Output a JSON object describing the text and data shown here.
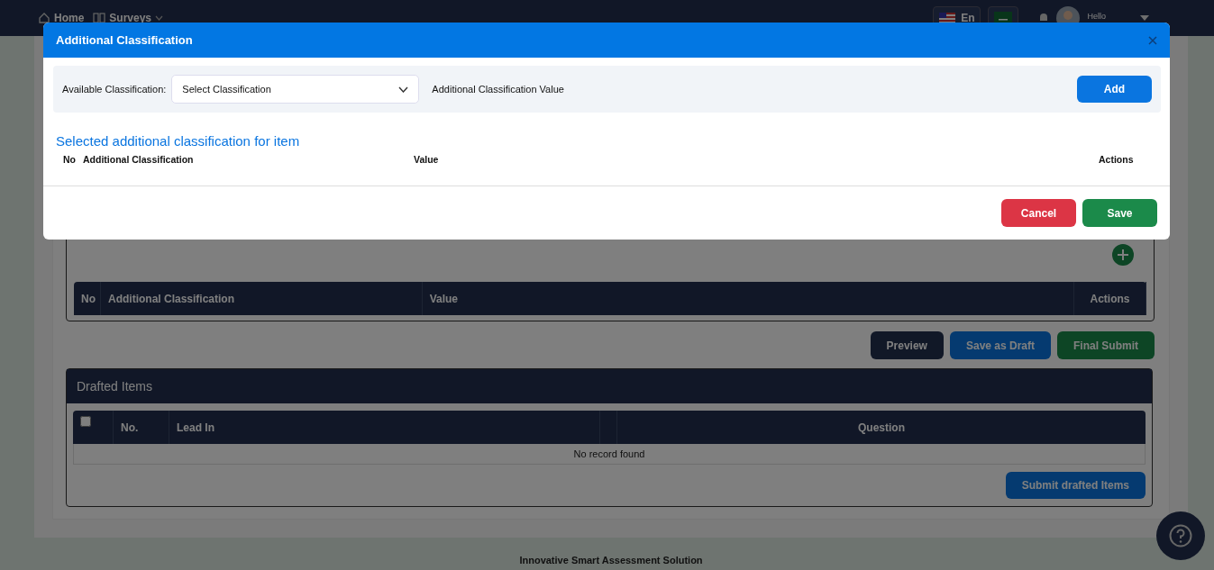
{
  "navbar": {
    "links": [
      {
        "label": "Home",
        "kind": "home",
        "dropdown": false
      },
      {
        "label": "Surveys",
        "kind": "book",
        "dropdown": true
      }
    ],
    "language": {
      "label": "En"
    },
    "greeting": "Hello"
  },
  "page": {
    "classification_table": {
      "columns": [
        "No",
        "Additional Classification",
        "Value",
        "Actions"
      ]
    },
    "actions": [
      {
        "label": "Preview",
        "kind": "dark"
      },
      {
        "label": "Save as Draft",
        "kind": "primary"
      },
      {
        "label": "Final Submit",
        "kind": "success"
      }
    ],
    "drafted": {
      "title": "Drafted Items",
      "select_all": {
        "checked": false
      },
      "columns": [
        "No.",
        "Lead In",
        "Question"
      ],
      "empty_message": "No record found",
      "submit_button": "Submit drafted Items"
    }
  },
  "modal": {
    "title": "Additional Classification",
    "filter": {
      "label": "Available Classification:",
      "select": {
        "value": "Select Classification"
      },
      "value_label": "Additional Classification Value",
      "add_button": "Add"
    },
    "section_title": "Selected additional classification for item",
    "table": {
      "columns": [
        "No",
        "Additional Classification",
        "Value",
        "Actions"
      ]
    },
    "buttons": [
      {
        "label": "Cancel",
        "kind": "danger"
      },
      {
        "label": "Save",
        "kind": "success"
      }
    ]
  },
  "footer": "Innovative Smart Assessment Solution"
}
